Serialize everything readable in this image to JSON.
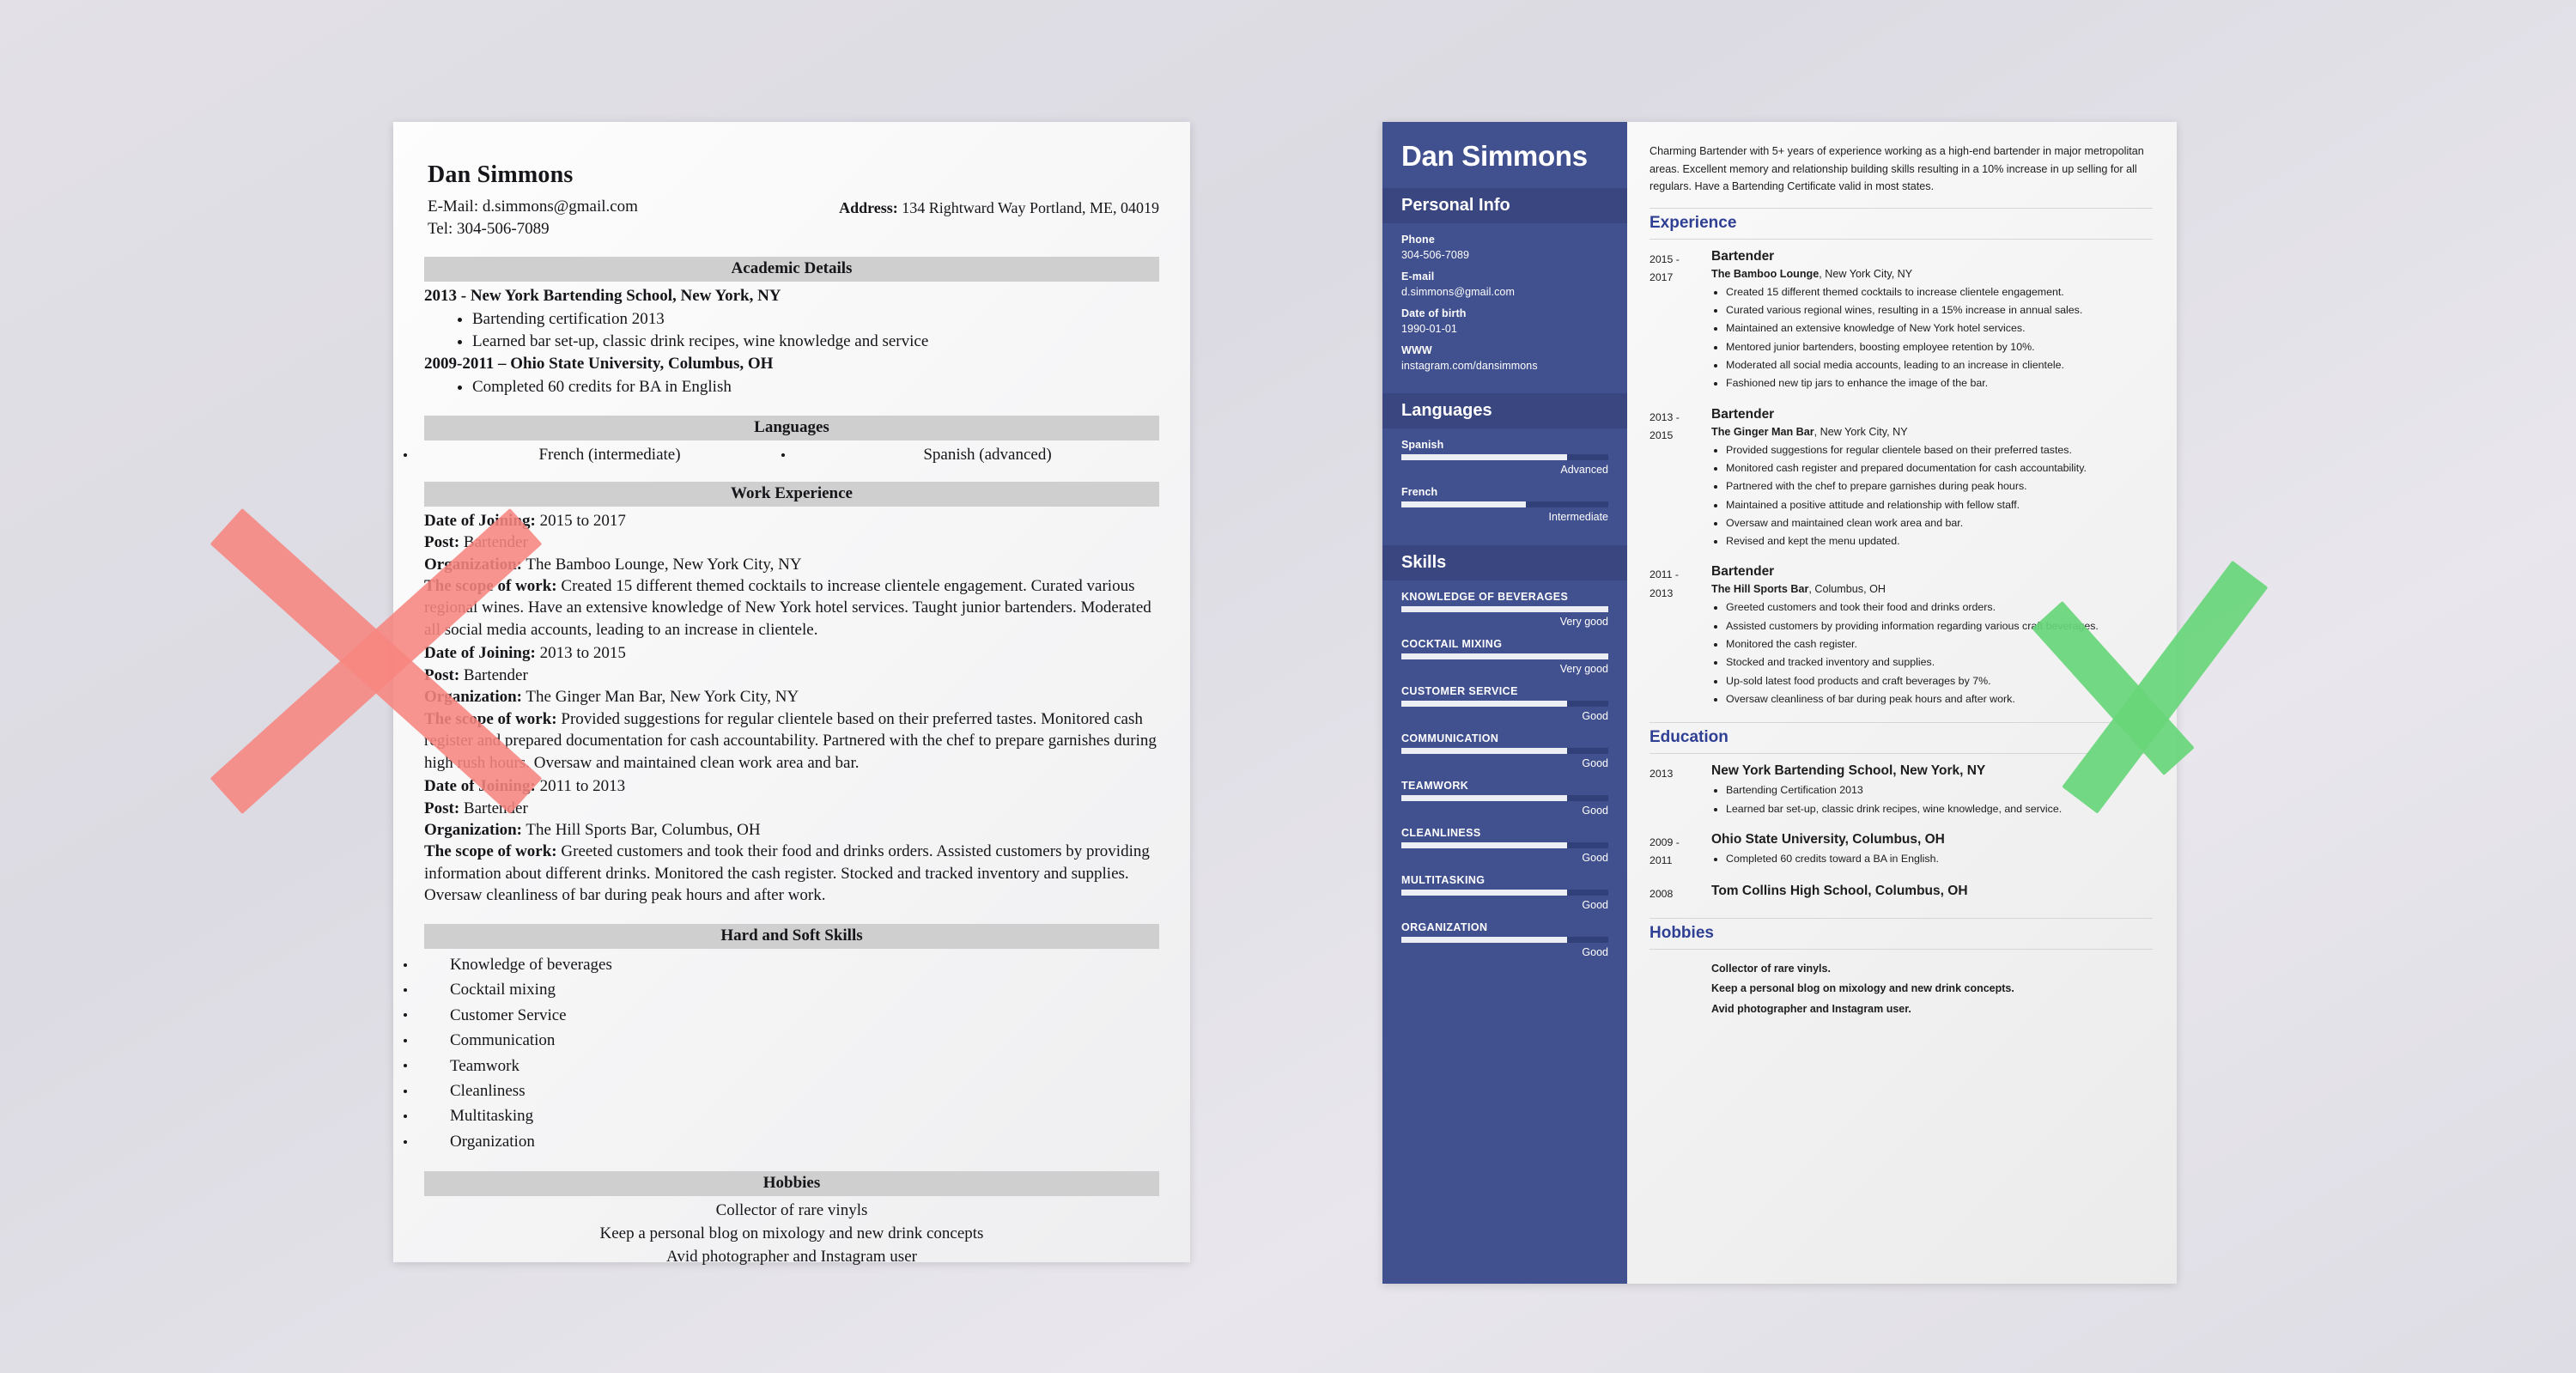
{
  "colors": {
    "sidebar": "#41508f",
    "sidebar_header": "#39467f",
    "accent_heading": "#2f3f93",
    "band_grey": "#cfcfcf",
    "mark_red": "#f78580",
    "mark_green": "#68d67a"
  },
  "bad_resume": {
    "name": "Dan Simmons",
    "email_label": "E-Mail:",
    "email": "d.simmons@gmail.com",
    "tel_label": "Tel:",
    "tel": "304-506-7089",
    "address_label": "Address:",
    "address": "134 Rightward Way Portland, ME, 04019",
    "academic_heading": "Academic Details",
    "academic": [
      {
        "title": "2013 - New York Bartending School, New York, NY",
        "bullets": [
          "Bartending certification 2013",
          "Learned bar set-up, classic drink recipes, wine knowledge and service"
        ]
      },
      {
        "title": "2009-2011 – Ohio State University, Columbus, OH",
        "bullets": [
          "Completed 60 credits for BA in English"
        ]
      }
    ],
    "languages_heading": "Languages",
    "languages": [
      "French (intermediate)",
      "Spanish (advanced)"
    ],
    "work_heading": "Work Experience",
    "work_labels": {
      "date": "Date of Joining:",
      "post": "Post:",
      "organization": "Organization:",
      "scope": "The scope of work:"
    },
    "work": [
      {
        "dates": "2015 to 2017",
        "post": "Bartender",
        "organization": "The Bamboo Lounge, New York City, NY",
        "scope": "Created 15 different themed cocktails to increase clientele engagement. Curated various regional wines. Have an extensive knowledge of New York hotel services. Taught junior bartenders. Moderated all social media accounts, leading to an increase in clientele."
      },
      {
        "dates": "2013 to 2015",
        "post": "Bartender",
        "organization": "The Ginger Man Bar, New York City, NY",
        "scope": "Provided suggestions for regular clientele based on their preferred tastes. Monitored cash register and prepared documentation for cash accountability. Partnered with the chef to prepare garnishes during high rush hours. Oversaw and maintained clean work area and bar."
      },
      {
        "dates": "2011 to 2013",
        "post": "Bartender",
        "organization": "The Hill Sports Bar, Columbus, OH",
        "scope": "Greeted customers and took their food and drinks orders. Assisted customers by providing information about different drinks. Monitored the cash register. Stocked and tracked inventory and supplies. Oversaw cleanliness of bar during peak hours and after work."
      }
    ],
    "skills_heading": "Hard and Soft Skills",
    "skills": [
      "Knowledge of beverages",
      "Cocktail mixing",
      "Customer Service",
      "Communication",
      "Teamwork",
      "Cleanliness",
      "Multitasking",
      "Organization"
    ],
    "hobbies_heading": "Hobbies",
    "hobbies": [
      "Collector of rare vinyls",
      "Keep a personal blog on mixology and new drink concepts",
      "Avid photographer and Instagram user"
    ]
  },
  "good_resume": {
    "name": "Dan Simmons",
    "sidebar": {
      "personal_info_heading": "Personal Info",
      "fields": [
        {
          "label": "Phone",
          "value": "304-506-7089"
        },
        {
          "label": "E-mail",
          "value": "d.simmons@gmail.com"
        },
        {
          "label": "Date of birth",
          "value": "1990-01-01"
        },
        {
          "label": "WWW",
          "value": "instagram.com/dansimmons"
        }
      ],
      "languages_heading": "Languages",
      "languages": [
        {
          "name": "Spanish",
          "level": "Advanced",
          "percent": 80
        },
        {
          "name": "French",
          "level": "Intermediate",
          "percent": 60
        }
      ],
      "skills_heading": "Skills",
      "skills": [
        {
          "name": "Knowledge of beverages",
          "level": "Very good",
          "percent": 100
        },
        {
          "name": "Cocktail mixing",
          "level": "Very good",
          "percent": 100
        },
        {
          "name": "Customer service",
          "level": "Good",
          "percent": 80
        },
        {
          "name": "Communication",
          "level": "Good",
          "percent": 80
        },
        {
          "name": "Teamwork",
          "level": "Good",
          "percent": 80
        },
        {
          "name": "Cleanliness",
          "level": "Good",
          "percent": 80
        },
        {
          "name": "Multitasking",
          "level": "Good",
          "percent": 80
        },
        {
          "name": "Organization",
          "level": "Good",
          "percent": 80
        }
      ]
    },
    "summary": "Charming Bartender with 5+ years of experience working as a high-end bartender in major metropolitan areas. Excellent memory and relationship building skills resulting in a 10% increase in up selling for all regulars. Have a Bartending Certificate valid in most states.",
    "experience_heading": "Experience",
    "experience": [
      {
        "date_from": "2015 -",
        "date_to": "2017",
        "role": "Bartender",
        "org_bold": "The Bamboo Lounge",
        "org_rest": ", New York City, NY",
        "bullets": [
          "Created 15 different themed cocktails to increase clientele engagement.",
          "Curated various regional wines, resulting in a 15% increase in annual sales.",
          "Maintained an extensive knowledge of New York hotel services.",
          "Mentored junior bartenders, boosting employee retention by 10%.",
          "Moderated all social media accounts, leading to an increase in clientele.",
          "Fashioned new tip jars to enhance the image of the bar."
        ]
      },
      {
        "date_from": "2013 -",
        "date_to": "2015",
        "role": "Bartender",
        "org_bold": "The Ginger Man Bar",
        "org_rest": ", New York City, NY",
        "bullets": [
          "Provided suggestions for regular clientele based on their preferred tastes.",
          "Monitored cash register and prepared documentation for cash accountability.",
          "Partnered with the chef to prepare garnishes during peak hours.",
          "Maintained a positive attitude and relationship with fellow staff.",
          "Oversaw and maintained clean work area and bar.",
          "Revised and kept the menu updated."
        ]
      },
      {
        "date_from": "2011 -",
        "date_to": "2013",
        "role": "Bartender",
        "org_bold": "The Hill Sports Bar",
        "org_rest": ", Columbus, OH",
        "bullets": [
          "Greeted customers and took their food and drinks orders.",
          "Assisted customers by providing information regarding various craft beverages.",
          "Monitored the cash register.",
          "Stocked and tracked inventory and supplies.",
          "Up-sold latest food products and craft beverages by 7%.",
          "Oversaw cleanliness of bar during peak hours and after work."
        ]
      }
    ],
    "education_heading": "Education",
    "education": [
      {
        "date_from": "2013",
        "date_to": "",
        "title": "New York Bartending School, New York, NY",
        "bullets": [
          "Bartending Certification 2013",
          "Learned bar set-up, classic drink recipes, wine knowledge, and service."
        ]
      },
      {
        "date_from": "2009 -",
        "date_to": "2011",
        "title": "Ohio State University, Columbus, OH",
        "bullets": [
          "Completed 60 credits toward a BA in English."
        ]
      },
      {
        "date_from": "2008",
        "date_to": "",
        "title": "Tom Collins High School, Columbus, OH",
        "bullets": []
      }
    ],
    "hobbies_heading": "Hobbies",
    "hobbies": [
      "Collector of rare vinyls.",
      "Keep a personal blog on mixology and new drink concepts.",
      "Avid photographer and Instagram user."
    ]
  },
  "annotations": {
    "reject_mark": "red-x",
    "approve_mark": "green-check"
  }
}
